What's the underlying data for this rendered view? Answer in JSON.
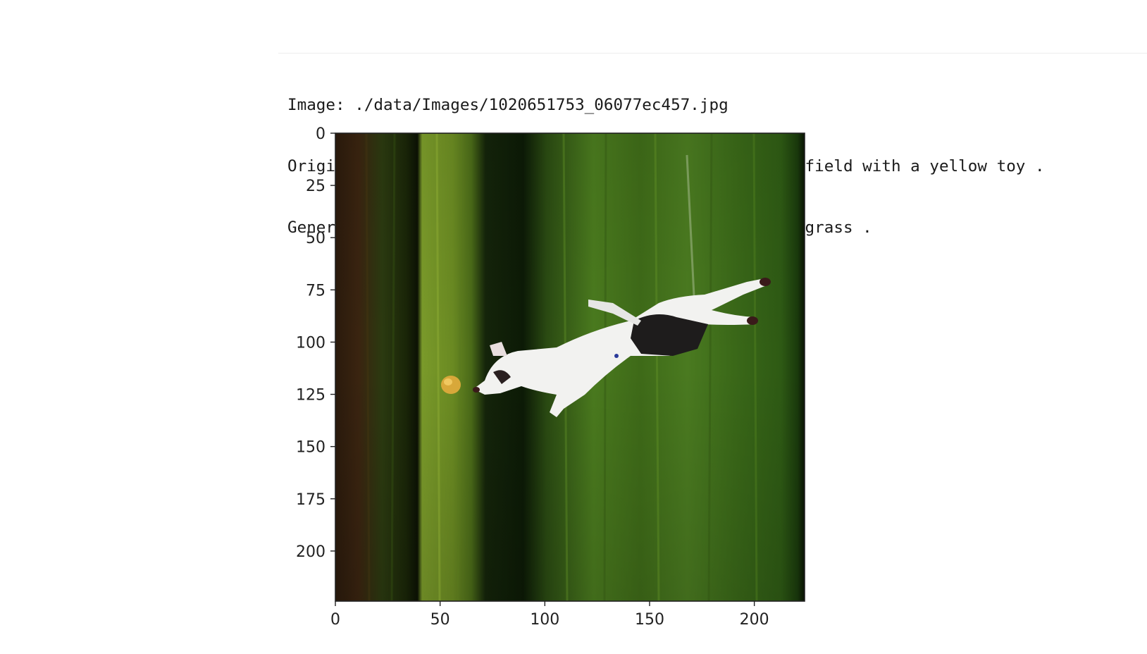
{
  "output": {
    "image_line": "Image: ./data/Images/1020651753_06077ec457.jpg",
    "original_caption_line": "Original Caption: The white dog is playing in a green field with a yellow toy .",
    "generated_caption_line": "Generated Caption: A black dog is running through the grass ."
  },
  "figure": {
    "image_description": "A white dog with dark patches running across a green grassy field toward a small yellow toy; the photo appears rotated 90 degrees.",
    "x_axis": {
      "range": [
        0,
        224
      ],
      "ticks": [
        0,
        50,
        100,
        150,
        200
      ]
    },
    "y_axis": {
      "range": [
        0,
        224
      ],
      "inverted": true,
      "ticks": [
        0,
        25,
        50,
        75,
        100,
        125,
        150,
        175,
        200
      ]
    }
  }
}
